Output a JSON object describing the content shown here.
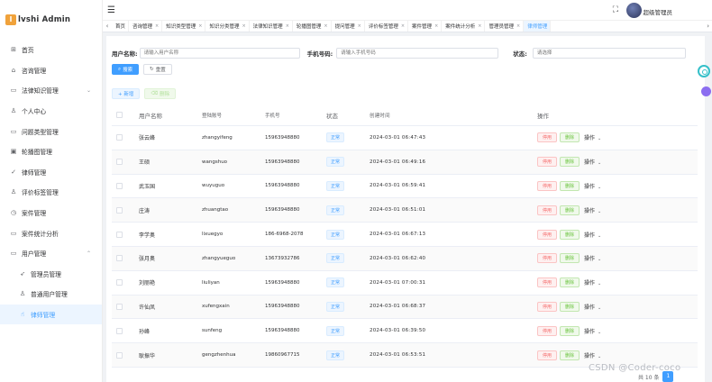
{
  "app": {
    "title": "lvshi Admin",
    "logo_letter": "l"
  },
  "header": {
    "username": "超级管理员"
  },
  "sidebar": {
    "items": [
      {
        "label": "首页",
        "icon": "grid-icon",
        "glyph": "⊞"
      },
      {
        "label": "咨询管理",
        "icon": "home-icon",
        "glyph": "⌂"
      },
      {
        "label": "法律知识管理",
        "icon": "monitor-icon",
        "glyph": "▭",
        "arrow": "⌄"
      },
      {
        "label": "个人中心",
        "icon": "user-icon",
        "glyph": "♙"
      },
      {
        "label": "问题类型管理",
        "icon": "monitor-icon",
        "glyph": "▭"
      },
      {
        "label": "轮播图管理",
        "icon": "image-icon",
        "glyph": "▣"
      },
      {
        "label": "律师管理",
        "icon": "check-icon",
        "glyph": "✓"
      },
      {
        "label": "评价标签管理",
        "icon": "user-icon",
        "glyph": "♙"
      },
      {
        "label": "案件管理",
        "icon": "clock-icon",
        "glyph": "◷"
      },
      {
        "label": "案件统计分析",
        "icon": "monitor-icon",
        "glyph": "▭"
      },
      {
        "label": "用户管理",
        "icon": "monitor-icon",
        "glyph": "▭",
        "arrow": "⌃"
      },
      {
        "label": "管理员管理",
        "icon": "send-icon",
        "glyph": "➶",
        "sub": true
      },
      {
        "label": "普通用户管理",
        "icon": "user-icon",
        "glyph": "♙",
        "sub": true
      },
      {
        "label": "律师管理",
        "icon": "hand-icon",
        "glyph": "☝",
        "sub": true,
        "active": true
      }
    ]
  },
  "tabs": [
    {
      "label": "首页",
      "closable": false
    },
    {
      "label": "咨询管理",
      "closable": true
    },
    {
      "label": "知识类型管理",
      "closable": true
    },
    {
      "label": "知识分类管理",
      "closable": true
    },
    {
      "label": "法律知识管理",
      "closable": true
    },
    {
      "label": "轮播图管理",
      "closable": true
    },
    {
      "label": "提问管理",
      "closable": true
    },
    {
      "label": "评价标签管理",
      "closable": true
    },
    {
      "label": "案件管理",
      "closable": true
    },
    {
      "label": "案件统计分析",
      "closable": true
    },
    {
      "label": "管理员管理",
      "closable": true
    },
    {
      "label": "律师管理",
      "closable": false,
      "active": true
    }
  ],
  "search": {
    "username_label": "用户名称:",
    "username_placeholder": "请输入用户名称",
    "phone_label": "手机号码:",
    "phone_placeholder": "请输入手机号码",
    "status_label": "状态:",
    "status_placeholder": "请选择",
    "search_button": "搜索",
    "reset_button": "重置"
  },
  "toolbar": {
    "add_label": "+ 新增",
    "delete_label": "删除"
  },
  "table": {
    "headers": [
      "用户名称",
      "登陆账号",
      "手机号",
      "状态",
      "创建时间",
      "操作"
    ],
    "rows": [
      {
        "name": "张云峰",
        "account": "zhangyifeng",
        "phone": "15963948880",
        "status": "正常",
        "time": "2024-03-01 06:47:43"
      },
      {
        "name": "王硕",
        "account": "wangshuo",
        "phone": "15963948880",
        "status": "正常",
        "time": "2024-03-01 06:49:16"
      },
      {
        "name": "武玉国",
        "account": "wuyuguo",
        "phone": "15963948880",
        "status": "正常",
        "time": "2024-03-01 06:59:41"
      },
      {
        "name": "庄涛",
        "account": "zhuangtao",
        "phone": "15963948880",
        "status": "正常",
        "time": "2024-03-01 06:51:01"
      },
      {
        "name": "李学奥",
        "account": "lixuegyo",
        "phone": "186-6968-2078",
        "status": "正常",
        "time": "2024-03-01 06:67:13"
      },
      {
        "name": "张月奥",
        "account": "zhangyueguo",
        "phone": "13673932786",
        "status": "正常",
        "time": "2024-03-01 06:62:40"
      },
      {
        "name": "刘丽艳",
        "account": "liuliyan",
        "phone": "15963948880",
        "status": "正常",
        "time": "2024-03-01 07:00:31"
      },
      {
        "name": "许仙凤",
        "account": "xufengxain",
        "phone": "15963948880",
        "status": "正常",
        "time": "2024-03-01 06:68:37"
      },
      {
        "name": "孙峰",
        "account": "sunfeng",
        "phone": "15963948880",
        "status": "正常",
        "time": "2024-03-01 06:39:50"
      },
      {
        "name": "耿振华",
        "account": "gengzhenhua",
        "phone": "19860967715",
        "status": "正常",
        "time": "2024-03-01 06:53:51"
      }
    ],
    "op_stop": "停用",
    "op_delete": "删除",
    "op_more": "操作"
  },
  "pagination": {
    "total": "共 10 条",
    "current": "1"
  },
  "watermark": "CSDN @Coder-coco"
}
